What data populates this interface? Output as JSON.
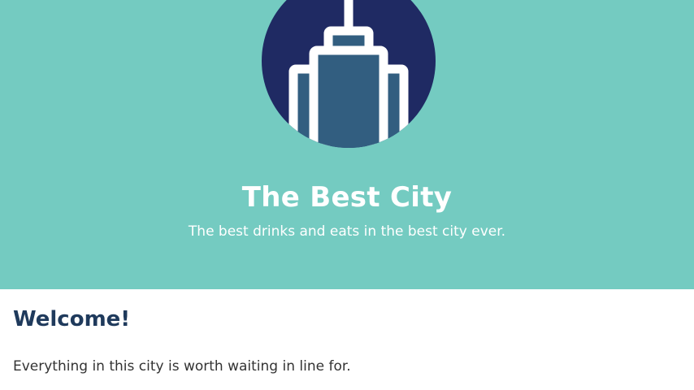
{
  "hero": {
    "title": "The Best City",
    "tagline": "The best drinks and eats in the best city ever."
  },
  "content": {
    "heading": "Welcome!",
    "text": "Everything in this city is worth waiting in line for."
  },
  "logo": {
    "icon": "skyscraper-icon"
  },
  "colors": {
    "hero_background": "#74cbc1",
    "logo_circle": "#1f2a63",
    "building_fill": "#325e80",
    "heading_text": "#1f3a5c",
    "body_text": "#333333"
  }
}
